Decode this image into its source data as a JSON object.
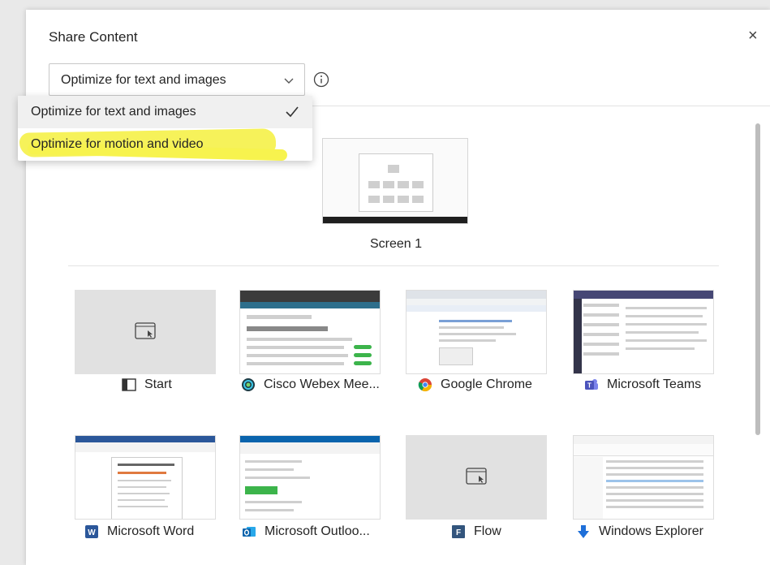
{
  "dialog": {
    "title": "Share Content",
    "close_glyph": "×"
  },
  "optimize_select": {
    "value": "Optimize for text and images",
    "options": [
      "Optimize for text and images",
      "Optimize for motion and video"
    ],
    "selected_index": 0,
    "highlighted_option": "Optimize for motion and video",
    "highlight_color": "#f6f25a"
  },
  "screens": [
    {
      "label": "Screen 1"
    }
  ],
  "apps": [
    {
      "label": "Start",
      "icon": "window-icon"
    },
    {
      "label": "Cisco Webex Mee...",
      "icon": "webex-icon"
    },
    {
      "label": "Google Chrome",
      "icon": "chrome-icon"
    },
    {
      "label": "Microsoft Teams",
      "icon": "teams-icon"
    },
    {
      "label": "Microsoft Word",
      "icon": "word-icon"
    },
    {
      "label": "Microsoft Outloo...",
      "icon": "outlook-icon"
    },
    {
      "label": "Flow",
      "icon": "flow-icon"
    },
    {
      "label": "Windows Explorer",
      "icon": "download-arrow-icon"
    }
  ]
}
